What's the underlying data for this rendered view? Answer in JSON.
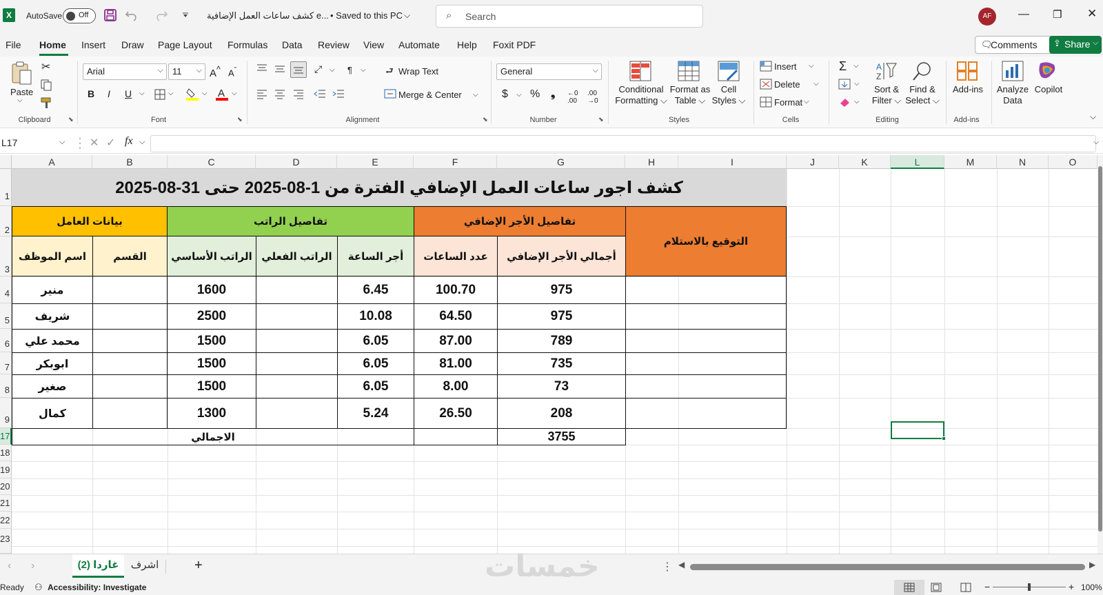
{
  "titlebar": {
    "autosave_label": "AutoSave",
    "autosave_state": "Off",
    "doc_title": "كشف ساعات العمل الإضافية e...",
    "saved_status": "• Saved to this PC",
    "search_placeholder": "Search",
    "user_initials": "AF"
  },
  "menu": {
    "items": [
      "File",
      "Home",
      "Insert",
      "Draw",
      "Page Layout",
      "Formulas",
      "Data",
      "Review",
      "View",
      "Automate",
      "Help",
      "Foxit PDF"
    ],
    "active": "Home",
    "comments_label": "Comments",
    "share_label": "Share"
  },
  "ribbon": {
    "clipboard": {
      "paste": "Paste",
      "group": "Clipboard"
    },
    "font": {
      "name": "Arial",
      "size": "11",
      "group": "Font"
    },
    "alignment": {
      "wrap_text": "Wrap Text",
      "merge_center": "Merge & Center",
      "group": "Alignment"
    },
    "number": {
      "format": "General",
      "group": "Number"
    },
    "styles": {
      "conditional_1": "Conditional",
      "conditional_2": "Formatting",
      "format_table_1": "Format as",
      "format_table_2": "Table",
      "cell_styles_1": "Cell",
      "cell_styles_2": "Styles",
      "group": "Styles"
    },
    "cells": {
      "insert": "Insert",
      "delete": "Delete",
      "format": "Format",
      "group": "Cells"
    },
    "editing": {
      "sort_1": "Sort &",
      "sort_2": "Filter",
      "find_1": "Find &",
      "find_2": "Select",
      "group": "Editing"
    },
    "addins": {
      "label": "Add-ins",
      "group": "Add-ins"
    },
    "analyze": {
      "line1": "Analyze",
      "line2": "Data"
    },
    "copilot": {
      "label": "Copilot"
    }
  },
  "formula_bar": {
    "name_box": "L17",
    "fx": "fx",
    "value": ""
  },
  "grid": {
    "columns": [
      "A",
      "B",
      "C",
      "D",
      "E",
      "F",
      "G",
      "H",
      "I",
      "J",
      "K",
      "L",
      "M",
      "N",
      "O"
    ],
    "row_headers": [
      "1",
      "2",
      "3",
      "4",
      "5",
      "6",
      "7",
      "8",
      "9",
      "17",
      "18",
      "19",
      "20",
      "21",
      "22",
      "23"
    ],
    "selected_cell": "L17"
  },
  "sheet": {
    "title": "كشف اجور ساعات العمل الإضافي  الفترة من 1-08-2025 حتى 31-08-2025",
    "group_headers": {
      "worker": "بيانات العامل",
      "salary": "تفاصيل الراتب",
      "overtime": "تفاصيل الأجر الإضافي",
      "signature": "التوقيع بالاستلام"
    },
    "column_headers": {
      "name": "اسم الموظف",
      "department": "القسم",
      "basic_salary": "الراتب الأساسي",
      "actual_salary": "الراتب الفعلي",
      "hour_wage": "أجر الساعة",
      "hours_count": "عدد الساعات",
      "total_overtime": "أجمالي الأجر الإضافي"
    },
    "rows": [
      {
        "name": "منير",
        "department": "",
        "basic_salary": "1600",
        "actual_salary": "",
        "hour_wage": "6.45",
        "hours_count": "100.70",
        "total_overtime": "975",
        "signature": ""
      },
      {
        "name": "شريف",
        "department": "",
        "basic_salary": "2500",
        "actual_salary": "",
        "hour_wage": "10.08",
        "hours_count": "64.50",
        "total_overtime": "975",
        "signature": ""
      },
      {
        "name": "محمد علي",
        "department": "",
        "basic_salary": "1500",
        "actual_salary": "",
        "hour_wage": "6.05",
        "hours_count": "87.00",
        "total_overtime": "789",
        "signature": ""
      },
      {
        "name": "ابوبكر",
        "department": "",
        "basic_salary": "1500",
        "actual_salary": "",
        "hour_wage": "6.05",
        "hours_count": "81.00",
        "total_overtime": "735",
        "signature": ""
      },
      {
        "name": "صغير",
        "department": "",
        "basic_salary": "1500",
        "actual_salary": "",
        "hour_wage": "6.05",
        "hours_count": "8.00",
        "total_overtime": "73",
        "signature": ""
      },
      {
        "name": "كمال",
        "department": "",
        "basic_salary": "1300",
        "actual_salary": "",
        "hour_wage": "5.24",
        "hours_count": "26.50",
        "total_overtime": "208",
        "signature": ""
      }
    ],
    "total_label": "الاجمالي",
    "total_value": "3755"
  },
  "tabs": {
    "active": "غاردا (2)",
    "other": "اشرف",
    "add": "+"
  },
  "status": {
    "ready": "Ready",
    "accessibility": "Accessibility: Investigate",
    "zoom": "100%",
    "watermark": "خمسات"
  },
  "colors": {
    "accent": "#107c41",
    "title_bg": "#d9d9d9",
    "worker_bg": "#ffc000",
    "worker_sub_bg": "#fff2cc",
    "salary_bg": "#92d050",
    "salary_sub_bg": "#e2efda",
    "overtime_bg": "#ed7d31",
    "overtime_sub_bg": "#fce4d6"
  }
}
